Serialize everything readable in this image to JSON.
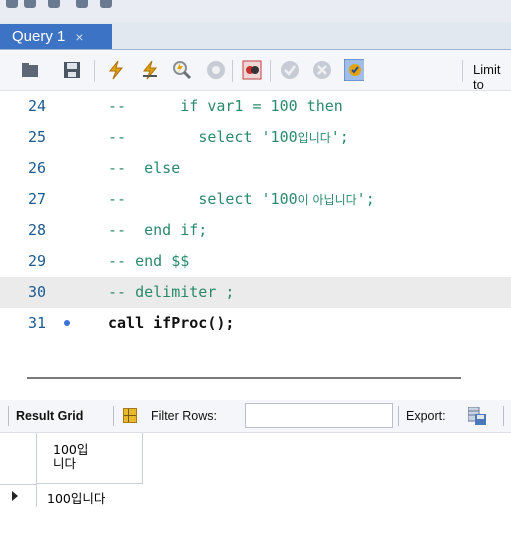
{
  "tab": {
    "title": "Query 1",
    "close": "×"
  },
  "toolbar": {
    "icons": [
      "open-folder-icon",
      "save-icon",
      "execute-icon",
      "execute-current-icon",
      "explain-icon",
      "stop-icon",
      "toggle-error-icon",
      "commit-icon",
      "rollback-icon",
      "autocommit-icon"
    ],
    "limit_label": "Limit to"
  },
  "editor": {
    "lines": [
      {
        "num": "24",
        "a": "--      ",
        "b": "if var1 = 100 then",
        "c": ""
      },
      {
        "num": "25",
        "a": "--        ",
        "b": "select '100",
        "c": "입니다",
        "d": "';"
      },
      {
        "num": "26",
        "a": "--  ",
        "b": "else",
        "c": ""
      },
      {
        "num": "27",
        "a": "--        ",
        "b": "select '100",
        "c": "이 아닙니다",
        "d": "';"
      },
      {
        "num": "28",
        "a": "--  ",
        "b": "end if;",
        "c": ""
      },
      {
        "num": "29",
        "a": "-- ",
        "b": "end $$",
        "c": ""
      },
      {
        "num": "30",
        "a": "-- ",
        "b": "delimiter ;",
        "c": ""
      },
      {
        "num": "31",
        "a": "call ",
        "b": "ifProc();",
        "c": ""
      }
    ]
  },
  "results": {
    "tab_label": "Result Grid",
    "filter_label": "Filter Rows:",
    "filter_value": "",
    "export_label": "Export:",
    "columns": [
      "100입니다"
    ],
    "rows": [
      [
        "100입니다"
      ]
    ]
  }
}
